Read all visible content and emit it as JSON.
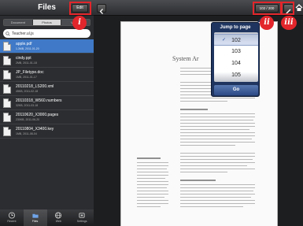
{
  "sidebar": {
    "title": "Files",
    "edit_label": "Edit",
    "segments": [
      "Document",
      "Photos",
      "Videos"
    ],
    "search_value": "Teacher.ul.js",
    "files": [
      {
        "name": "apple.pdf",
        "meta": "1.3MB, 2011-01-20",
        "selected": true
      },
      {
        "name": "cindy.ppt",
        "meta": "2MB, 2011-01-18",
        "selected": false
      },
      {
        "name": "JP_Filetype.doc",
        "meta": "1MB, 2011-01-17",
        "selected": false
      },
      {
        "name": "20110218_LS200.xml",
        "meta": "45KB, 2011-02-18",
        "selected": false
      },
      {
        "name": "20110318_W560.numbers",
        "meta": "32KB, 2011-03-18",
        "selected": false
      },
      {
        "name": "20110620_X3000.pages",
        "meta": "230KB, 2011-06-20",
        "selected": false
      },
      {
        "name": "20110804_X3400.key",
        "meta": "1MB, 2011-08-04",
        "selected": false
      }
    ],
    "tabs": [
      {
        "label": "Recent",
        "icon": "clock-icon"
      },
      {
        "label": "Files",
        "icon": "folder-icon"
      },
      {
        "label": "Web",
        "icon": "globe-icon"
      },
      {
        "label": "Settings",
        "icon": "settings-icon"
      }
    ]
  },
  "viewer": {
    "page_indicator": "102 / 200",
    "document_title": "System Ar",
    "jump": {
      "title": "Jump to page",
      "options": [
        "102",
        "103",
        "104",
        "105"
      ],
      "selected": "102",
      "go_label": "Go"
    }
  },
  "annotations": [
    "i",
    "ii",
    "iii"
  ],
  "colors": {
    "accent": "#e2262b",
    "selection": "#3f79c7",
    "popover": "#1f3560"
  }
}
